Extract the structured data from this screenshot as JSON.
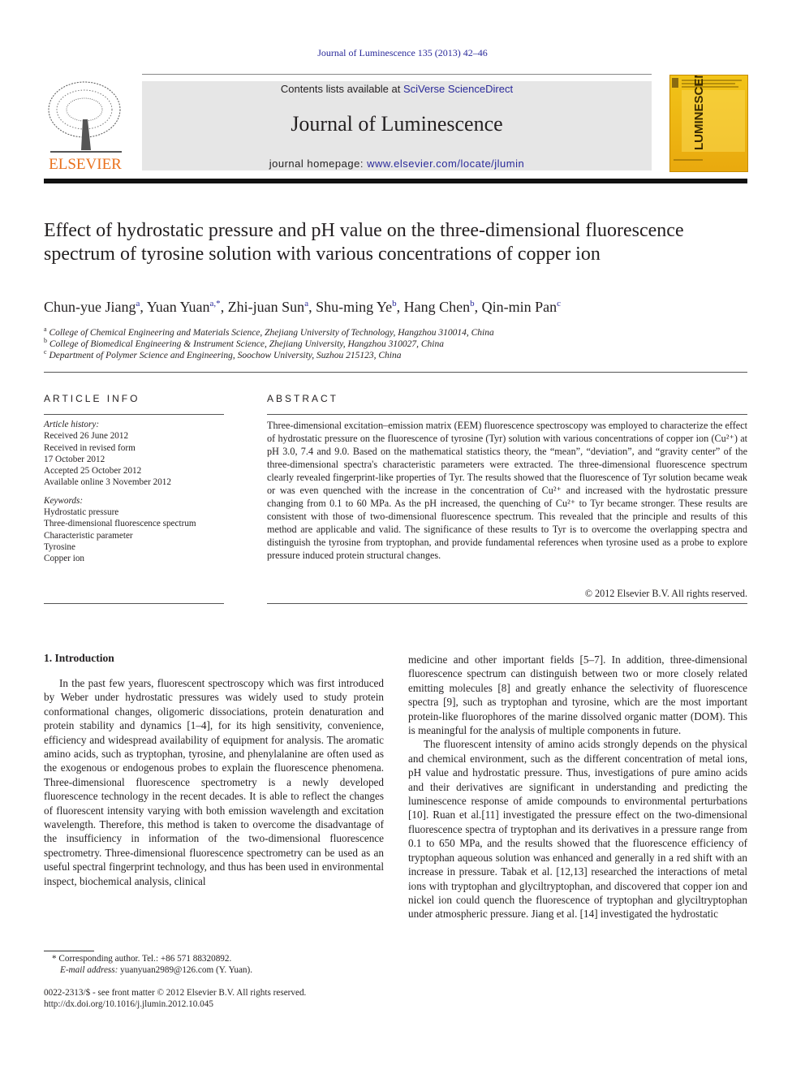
{
  "header": {
    "citation": "Journal of Luminescence 135 (2013) 42–46",
    "contents_prefix": "Contents lists available at ",
    "contents_link": "SciVerse ScienceDirect",
    "journal_title": "Journal of Luminescence",
    "homepage_prefix": "journal homepage: ",
    "homepage_link": "www.elsevier.com/locate/jlumin",
    "publisher": "ELSEVIER",
    "cover_text": "LUMINESCENCE",
    "colors": {
      "link": "#2a2a9a",
      "elsevier_orange": "#e9711c",
      "cover_yellow": "#f2c418"
    }
  },
  "article": {
    "title": "Effect of hydrostatic pressure and pH value on the three-dimensional fluorescence spectrum of tyrosine solution with various concentrations of copper ion",
    "authors": [
      {
        "name": "Chun-yue Jiang",
        "sup": "a"
      },
      {
        "name": "Yuan Yuan",
        "sup": "a,*"
      },
      {
        "name": "Zhi-juan Sun",
        "sup": "a"
      },
      {
        "name": "Shu-ming Ye",
        "sup": "b"
      },
      {
        "name": "Hang Chen",
        "sup": "b"
      },
      {
        "name": "Qin-min Pan",
        "sup": "c"
      }
    ],
    "affiliations": [
      {
        "sup": "a",
        "text": "College of Chemical Engineering and Materials Science, Zhejiang University of Technology, Hangzhou 310014, China"
      },
      {
        "sup": "b",
        "text": "College of Biomedical Engineering & Instrument Science, Zhejiang University, Hangzhou 310027, China"
      },
      {
        "sup": "c",
        "text": "Department of Polymer Science and Engineering, Soochow University, Suzhou 215123, China"
      }
    ]
  },
  "article_info": {
    "heading": "ARTICLE INFO",
    "history_label": "Article history:",
    "history": [
      "Received 26 June 2012",
      "Received in revised form",
      "17 October 2012",
      "Accepted 25 October 2012",
      "Available online 3 November 2012"
    ],
    "keywords_label": "Keywords:",
    "keywords": [
      "Hydrostatic pressure",
      "Three-dimensional fluorescence spectrum",
      "Characteristic parameter",
      "Tyrosine",
      "Copper ion"
    ]
  },
  "abstract": {
    "heading": "ABSTRACT",
    "text": "Three-dimensional excitation–emission matrix (EEM) fluorescence spectroscopy was employed to characterize the effect of hydrostatic pressure on the fluorescence of tyrosine (Tyr) solution with various concentrations of copper ion (Cu²⁺) at pH 3.0, 7.4 and 9.0. Based on the mathematical statistics theory, the “mean”, “deviation”, and “gravity center” of the three-dimensional spectra's characteristic parameters were extracted. The three-dimensional fluorescence spectrum clearly revealed fingerprint-like properties of Tyr. The results showed that the fluorescence of Tyr solution became weak or was even quenched with the increase in the concentration of Cu²⁺ and increased with the hydrostatic pressure changing from 0.1 to 60 MPa. As the pH increased, the quenching of Cu²⁺ to Tyr became stronger. These results are consistent with those of two-dimensional fluorescence spectrum. This revealed that the principle and results of this method are applicable and valid. The significance of these results to Tyr is to overcome the overlapping spectra and distinguish the tyrosine from tryptophan, and provide fundamental references when tyrosine used as a probe to explore pressure induced protein structural changes.",
    "copyright": "© 2012 Elsevier B.V. All rights reserved."
  },
  "body": {
    "section_heading": "1.  Introduction",
    "col1_para1": "In the past few years, fluorescent spectroscopy which was first introduced by Weber under hydrostatic pressures was widely used to study protein conformational changes, oligomeric dissociations, protein denaturation and protein stability and dynamics [1–4], for its high sensitivity, convenience, efficiency and widespread availability of equipment for analysis. The aromatic amino acids, such as tryptophan, tyrosine, and phenylalanine are often used as the exogenous or endogenous probes to explain the fluorescence phenomena. Three-dimensional fluorescence spectrometry is a newly developed fluorescence technology in the recent decades. It is able to reflect the changes of fluorescent intensity varying with both emission wavelength and excitation wavelength. Therefore, this method is taken to overcome the disadvantage of the insufficiency in information of the two-dimensional fluorescence spectrometry. Three-dimensional fluorescence spectrometry can be used as an useful spectral fingerprint technology, and thus has been used in environmental inspect, biochemical analysis, clinical",
    "col2_para1": "medicine and other important fields [5–7]. In addition, three-dimensional fluorescence spectrum can distinguish between two or more closely related emitting molecules [8] and greatly enhance the selectivity of fluorescence spectra [9], such as tryptophan and tyrosine, which are the most important protein-like fluorophores of the marine dissolved organic matter (DOM). This is meaningful for the analysis of multiple components in future.",
    "col2_para2": "The fluorescent intensity of amino acids strongly depends on the physical and chemical environment, such as the different concentration of metal ions, pH value and hydrostatic pressure. Thus, investigations of pure amino acids and their derivatives are significant in understanding and predicting the luminescence response of amide compounds to environmental perturbations [10]. Ruan et al.[11] investigated the pressure effect on the two-dimensional fluorescence spectra of tryptophan and its derivatives in a pressure range from 0.1 to 650 MPa, and the results showed that the fluorescence efficiency of tryptophan aqueous solution was enhanced and generally in a red shift with an increase in pressure. Tabak et al. [12,13] researched the interactions of metal ions with tryptophan and glyciltryptophan, and discovered that copper ion and nickel ion could quench the fluorescence of tryptophan and glyciltryptophan under atmospheric pressure. Jiang et al. [14] investigated the hydrostatic"
  },
  "footnotes": {
    "corresponding": "* Corresponding author. Tel.: +86 571 88320892.",
    "email_label": "E-mail address:",
    "email": " yuanyuan2989@126.com (Y. Yuan).",
    "issn": "0022-2313/$ - see front matter © 2012 Elsevier B.V. All rights reserved.",
    "doi": "http://dx.doi.org/10.1016/j.jlumin.2012.10.045"
  }
}
